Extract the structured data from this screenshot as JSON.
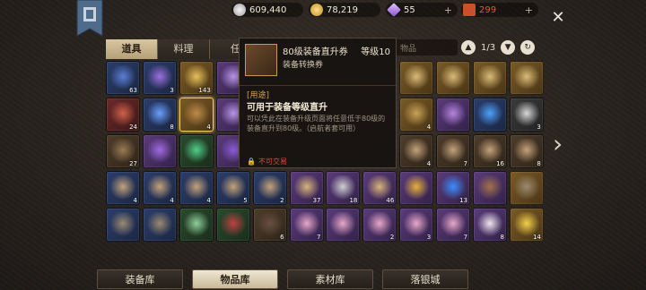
{
  "currencies": {
    "silver": {
      "value": "609,440",
      "icon": "silver-coin-icon",
      "color": "#c8c8c8"
    },
    "gold": {
      "value": "78,219",
      "icon": "gold-coin-icon",
      "color": "#e6b53a"
    },
    "gem": {
      "value": "55",
      "icon": "diamond-icon",
      "color": "#a873e0"
    },
    "ticket": {
      "value": "299",
      "icon": "ticket-icon",
      "color": "#e8562c"
    },
    "plus": "+"
  },
  "tabs": [
    "道具",
    "料理",
    "任"
  ],
  "search": {
    "placeholder": "物品"
  },
  "pager": {
    "text": "1/3"
  },
  "tooltip": {
    "name": "80级装备直升券",
    "level": "等级10",
    "type": "装备转换券",
    "usage_header": "[用途]",
    "usage": "可用于装备等级直升",
    "desc": "可以凭此在装备升级页面将任意低于80级的装备直升到80级。（启航者套可用）",
    "lock": "不可交易"
  },
  "close": "✕",
  "bottom_tabs": [
    "装备库",
    "物品库",
    "素材库",
    "落银城"
  ],
  "grid": [
    {
      "q": "blue",
      "icon": "ticket-10v-icon",
      "count": "63",
      "row": 0,
      "col": 0
    },
    {
      "q": "blue",
      "icon": "scroll-purple-icon",
      "count": "3",
      "row": 0,
      "col": 1
    },
    {
      "q": "gold",
      "icon": "gold-key-icon",
      "count": "143",
      "row": 0,
      "col": 2
    },
    {
      "q": "purple",
      "icon": "envelope-icon",
      "count": "",
      "row": 0,
      "col": 3
    },
    {
      "q": "gold",
      "icon": "map-scroll-icon",
      "count": "",
      "row": 0,
      "col": 8
    },
    {
      "q": "gold",
      "icon": "map-scroll-icon",
      "count": "",
      "row": 0,
      "col": 9
    },
    {
      "q": "gold",
      "icon": "map-scroll-icon",
      "count": "",
      "row": 0,
      "col": 10
    },
    {
      "q": "gold",
      "icon": "map-scroll-icon",
      "count": "",
      "row": 0,
      "col": 11
    },
    {
      "q": "red",
      "icon": "ticket-30v-icon",
      "count": "24",
      "row": 1,
      "col": 0
    },
    {
      "q": "blue",
      "icon": "blue-crystal-icon",
      "count": "8",
      "row": 1,
      "col": 1
    },
    {
      "q": "gold",
      "icon": "equip-ticket-icon",
      "count": "4",
      "row": 1,
      "col": 2,
      "selected": true
    },
    {
      "q": "purple",
      "icon": "envelope-icon",
      "count": "",
      "row": 1,
      "col": 3
    },
    {
      "q": "gold",
      "icon": "compass-icon",
      "count": "4",
      "row": 1,
      "col": 8
    },
    {
      "q": "purple",
      "icon": "pouch-icon",
      "count": "",
      "row": 1,
      "col": 9
    },
    {
      "q": "blue",
      "icon": "butterfly-icon",
      "count": "",
      "row": 1,
      "col": 10
    },
    {
      "q": "grey",
      "icon": "sealed-letter-icon",
      "count": "3",
      "row": 1,
      "col": 11
    },
    {
      "q": "brown",
      "icon": "backpack-icon",
      "count": "27",
      "row": 2,
      "col": 0
    },
    {
      "q": "purple",
      "icon": "purple-crystal-icon",
      "count": "",
      "row": 2,
      "col": 1
    },
    {
      "q": "green",
      "icon": "green-gem-icon",
      "count": "",
      "row": 2,
      "col": 2
    },
    {
      "q": "purple",
      "icon": "purple-gem-icon",
      "count": "",
      "row": 2,
      "col": 3
    },
    {
      "q": "brown",
      "icon": "treasure-map-icon",
      "count": "4",
      "row": 2,
      "col": 8
    },
    {
      "q": "brown",
      "icon": "treasure-map-icon",
      "count": "7",
      "row": 2,
      "col": 9
    },
    {
      "q": "brown",
      "icon": "treasure-map-icon",
      "count": "16",
      "row": 2,
      "col": 10
    },
    {
      "q": "brown",
      "icon": "treasure-map-icon",
      "count": "8",
      "row": 2,
      "col": 11
    },
    {
      "q": "blue",
      "icon": "treasure-map-icon",
      "count": "4",
      "row": 3,
      "col": 0
    },
    {
      "q": "blue",
      "icon": "treasure-map-icon",
      "count": "4",
      "row": 3,
      "col": 1
    },
    {
      "q": "blue",
      "icon": "treasure-map-icon",
      "count": "4",
      "row": 3,
      "col": 2
    },
    {
      "q": "blue",
      "icon": "treasure-map-icon",
      "count": "5",
      "row": 3,
      "col": 3
    },
    {
      "q": "blue",
      "icon": "treasure-map-icon",
      "count": "2",
      "row": 3,
      "col": 4
    },
    {
      "q": "purple",
      "icon": "wood-log-icon",
      "count": "37",
      "row": 3,
      "col": 5
    },
    {
      "q": "purple",
      "icon": "stone-icon",
      "count": "18",
      "row": 3,
      "col": 6
    },
    {
      "q": "purple",
      "icon": "wood-log-icon",
      "count": "46",
      "row": 3,
      "col": 7
    },
    {
      "q": "purple",
      "icon": "gold-nugget-icon",
      "count": "",
      "row": 3,
      "col": 8
    },
    {
      "q": "purple",
      "icon": "blue-drop-icon",
      "count": "13",
      "row": 3,
      "col": 9
    },
    {
      "q": "purple",
      "icon": "sack-icon",
      "count": "",
      "row": 3,
      "col": 10
    },
    {
      "q": "gold",
      "icon": "fishing-rod-icon",
      "count": "",
      "row": 3,
      "col": 11
    },
    {
      "q": "blue",
      "icon": "fishing-rod-icon",
      "count": "",
      "row": 4,
      "col": 0
    },
    {
      "q": "blue",
      "icon": "fishing-rod-icon",
      "count": "",
      "row": 4,
      "col": 1
    },
    {
      "q": "green",
      "icon": "shell-icon",
      "count": "",
      "row": 4,
      "col": 2
    },
    {
      "q": "green",
      "icon": "worm-icon",
      "count": "",
      "row": 4,
      "col": 3
    },
    {
      "q": "brown",
      "icon": "boot-icon",
      "count": "6",
      "row": 4,
      "col": 4
    },
    {
      "q": "purple",
      "icon": "clam-icon",
      "count": "7",
      "row": 4,
      "col": 5
    },
    {
      "q": "purple",
      "icon": "clam-icon",
      "count": "",
      "row": 4,
      "col": 6
    },
    {
      "q": "purple",
      "icon": "clam-icon",
      "count": "2",
      "row": 4,
      "col": 7
    },
    {
      "q": "purple",
      "icon": "clam-icon",
      "count": "3",
      "row": 4,
      "col": 8
    },
    {
      "q": "purple",
      "icon": "clam-icon",
      "count": "7",
      "row": 4,
      "col": 9
    },
    {
      "q": "purple",
      "icon": "cat-plush-icon",
      "count": "8",
      "row": 4,
      "col": 10
    },
    {
      "q": "gold",
      "icon": "chick-plush-icon",
      "count": "14",
      "row": 4,
      "col": 11
    }
  ]
}
